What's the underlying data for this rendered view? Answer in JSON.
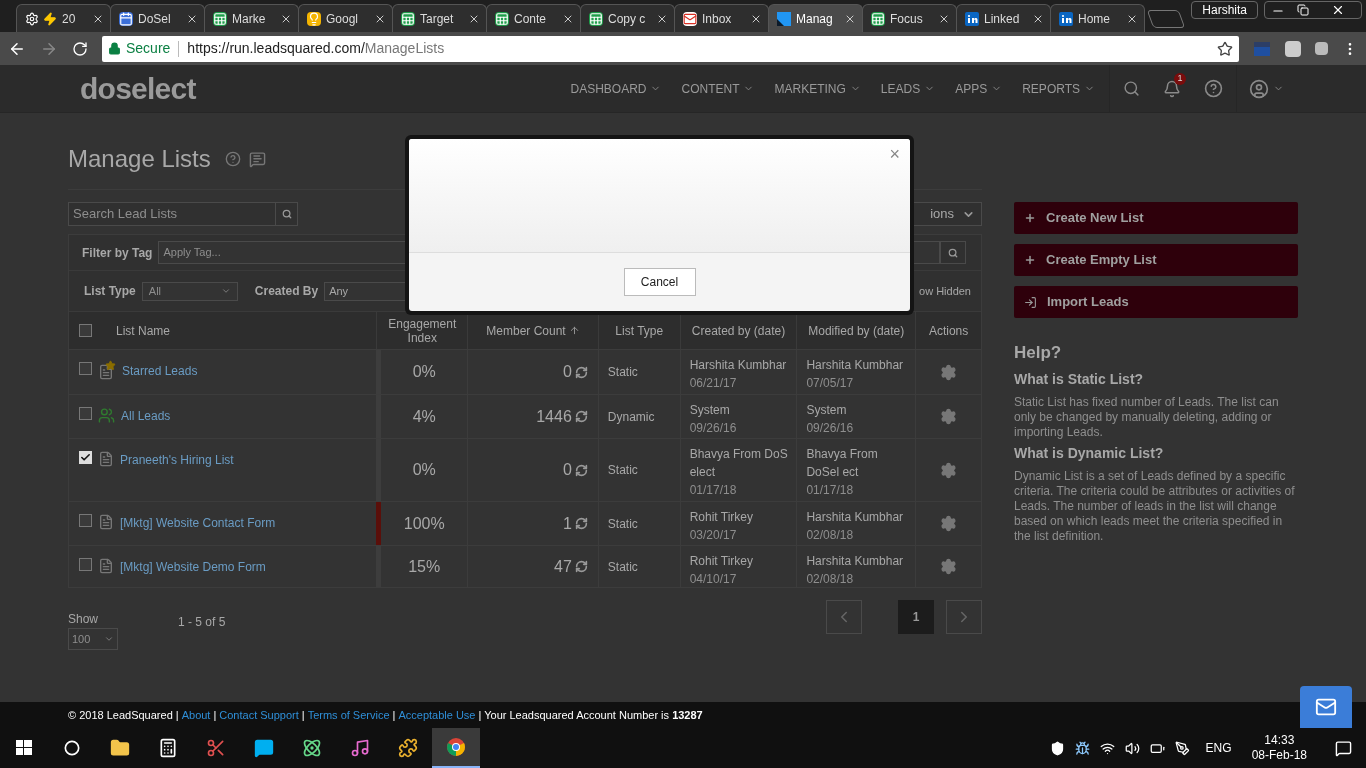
{
  "browser": {
    "tabs": [
      {
        "label": "20",
        "kind": "bolt",
        "selected": false
      },
      {
        "label": "DoSel",
        "kind": "calendar",
        "selected": false
      },
      {
        "label": "Marke",
        "kind": "sheet",
        "selected": false
      },
      {
        "label": "Googl",
        "kind": "bulb",
        "selected": false
      },
      {
        "label": "Target",
        "kind": "sheet",
        "selected": false
      },
      {
        "label": "Conte",
        "kind": "sheet",
        "selected": false
      },
      {
        "label": "Copy c",
        "kind": "sheet",
        "selected": false
      },
      {
        "label": "Inbox",
        "kind": "mail",
        "selected": false
      },
      {
        "label": "Manag",
        "kind": "app",
        "selected": true
      },
      {
        "label": "Focus",
        "kind": "sheet",
        "selected": false
      },
      {
        "label": "Linked",
        "kind": "social",
        "selected": false
      },
      {
        "label": "Home",
        "kind": "social",
        "selected": false
      }
    ],
    "profile": "Harshita",
    "secure": "Secure",
    "url_host": "https://run.leadsquared.com/",
    "url_path": "ManageLists"
  },
  "nav": {
    "logo": "doselect",
    "menu": [
      "DASHBOARD",
      "CONTENT",
      "MARKETING",
      "LEADS",
      "APPS",
      "REPORTS"
    ],
    "notification_count": "1"
  },
  "page": {
    "title": "Manage Lists",
    "search_placeholder": "Search Lead Lists",
    "actions_select": "ions",
    "filter_tag_label": "Filter by Tag",
    "filter_tag_placeholder": "Apply Tag...",
    "list_type_label": "List Type",
    "list_type_value": "All",
    "created_by_label": "Created By",
    "created_by_value": "Any",
    "show_hidden": "ow Hidden"
  },
  "table": {
    "header_checked": false,
    "columns": [
      "List Name",
      "Engagement Index",
      "Member Count",
      "List Type",
      "Created by (date)",
      "Modified by (date)",
      "Actions"
    ],
    "rows": [
      {
        "kind": "starred",
        "name": "Starred Leads",
        "checked": false,
        "engagement": "0%",
        "color": "#3d3d3d",
        "count": "0",
        "type": "Static",
        "created_by": "Harshita Kumbhar",
        "created_date": "06/21/17",
        "modified_by": "Harshita Kumbhar",
        "modified_date": "07/05/17"
      },
      {
        "kind": "users",
        "name": "All Leads",
        "checked": false,
        "engagement": "4%",
        "color": "#3d3d3d",
        "count": "1446",
        "type": "Dynamic",
        "created_by": "System",
        "created_date": "09/26/16",
        "modified_by": "System",
        "modified_date": "09/26/16"
      },
      {
        "kind": "list",
        "name": "Praneeth's Hiring List",
        "checked": true,
        "engagement": "0%",
        "color": "#3d3d3d",
        "count": "0",
        "type": "Static",
        "created_by": "Bhavya From DoS elect",
        "created_date": "01/17/18",
        "modified_by": "Bhavya From DoSel ect",
        "modified_date": "01/17/18"
      },
      {
        "kind": "list",
        "name": "[Mktg] Website Contact Form",
        "checked": false,
        "engagement": "100%",
        "color": "#5a0f0a",
        "count": "1",
        "type": "Static",
        "created_by": "Rohit Tirkey",
        "created_date": "03/20/17",
        "modified_by": "Harshita Kumbhar",
        "modified_date": "02/08/18"
      },
      {
        "kind": "list",
        "name": "[Mktg] Website Demo Form",
        "checked": false,
        "engagement": "15%",
        "color": "#3d3d3d",
        "count": "47",
        "type": "Static",
        "created_by": "Rohit Tirkey",
        "created_date": "04/10/17",
        "modified_by": "Harshita Kumbhar",
        "modified_date": "02/08/18"
      }
    ]
  },
  "pagination": {
    "show_label": "Show",
    "show_value": "100",
    "range": "1 - 5 of 5",
    "page": "1"
  },
  "sidebar": {
    "buttons": [
      {
        "kind": "plus",
        "label": "Create New List"
      },
      {
        "kind": "plus",
        "label": "Create Empty List"
      },
      {
        "kind": "import",
        "label": "Import Leads"
      }
    ],
    "help_title": "Help?",
    "sections": [
      {
        "heading": "What is Static List?",
        "text": "Static List has fixed number of Leads. The list can only be changed by manually deleting, adding or importing Leads."
      },
      {
        "heading": "What is Dynamic List?",
        "text": "Dynamic List is a set of Leads defined by a specific criteria. The criteria could be attributes or activities of Leads. The number of leads in the list will change based on which leads meet the criteria specified in the list definition."
      }
    ]
  },
  "modal": {
    "close": "×",
    "cancel": "Cancel"
  },
  "footer": [
    {
      "kind": "text",
      "text": "© 2018 LeadSquared |"
    },
    {
      "kind": "link",
      "text": "About"
    },
    {
      "kind": "text",
      "text": "|"
    },
    {
      "kind": "link",
      "text": "Contact Support"
    },
    {
      "kind": "text",
      "text": "|"
    },
    {
      "kind": "link",
      "text": "Terms of Service"
    },
    {
      "kind": "text",
      "text": "|"
    },
    {
      "kind": "link",
      "text": "Acceptable Use"
    },
    {
      "kind": "text",
      "text": "| Your Leadsquared Account Number is **13287**"
    }
  ],
  "taskbar": {
    "apps": [
      {
        "kind": "folder",
        "selected": false
      },
      {
        "kind": "calculator",
        "selected": false
      },
      {
        "kind": "snip",
        "selected": false
      },
      {
        "kind": "skype",
        "selected": false
      },
      {
        "kind": "atom",
        "selected": false
      },
      {
        "kind": "music",
        "selected": false
      },
      {
        "kind": "slack",
        "selected": false
      },
      {
        "kind": "chrome",
        "selected": true
      }
    ],
    "language": "ENG",
    "time": "14:33",
    "date": "08-Feb-18"
  }
}
